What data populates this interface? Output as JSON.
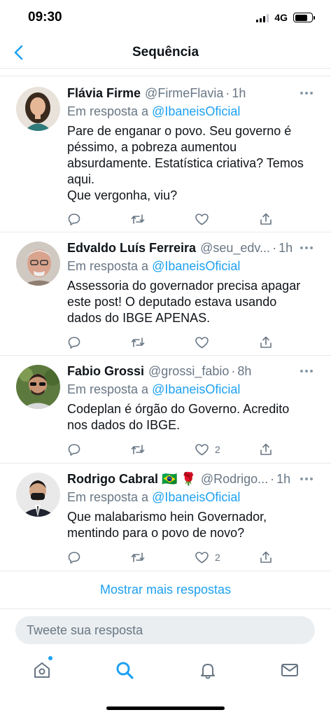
{
  "status_bar": {
    "time": "09:30",
    "network": "4G"
  },
  "header": {
    "title": "Sequência"
  },
  "reply_prefix": "Em resposta a",
  "tweets": [
    {
      "name": "Flávia Firme",
      "handle": "@FirmeFlavia",
      "time": "1h",
      "reply_to": "@IbaneisOficial",
      "text_lines": [
        "Pare de enganar o povo. Seu governo é",
        "péssimo, a pobreza aumentou",
        "absurdamente. Estatística criativa? Temos",
        "aqui.",
        "Que vergonha, viu?"
      ],
      "likes": ""
    },
    {
      "name": "Edvaldo Luís Ferreira",
      "handle": "@seu_edv...",
      "time": "1h",
      "reply_to": "@IbaneisOficial",
      "text_lines": [
        "Assessoria do governador precisa apagar",
        "este post! O deputado estava usando",
        "dados do IBGE APENAS."
      ],
      "likes": ""
    },
    {
      "name": "Fabio Grossi",
      "handle": "@grossi_fabio",
      "time": "8h",
      "reply_to": "@IbaneisOficial",
      "text_lines": [
        "Codeplan é órgão do Governo. Acredito",
        "nos dados do IBGE."
      ],
      "likes": "2"
    },
    {
      "name": "Rodrigo Cabral 🇧🇷 🌹",
      "handle": "@Rodrigo...",
      "time": "1h",
      "reply_to": "@IbaneisOficial",
      "text_lines": [
        "Que malabarismo hein Governador,",
        "mentindo para o povo de novo?"
      ],
      "likes": "2"
    }
  ],
  "more_replies": "Mostrar mais respostas",
  "composer": {
    "placeholder": "Tweete sua resposta"
  },
  "tabs": [
    "home-icon",
    "search-icon",
    "bell-icon",
    "mail-icon"
  ],
  "colors": {
    "accent": "#1da1f2",
    "secondary_text": "#687684",
    "divider": "#e6e9ec"
  }
}
